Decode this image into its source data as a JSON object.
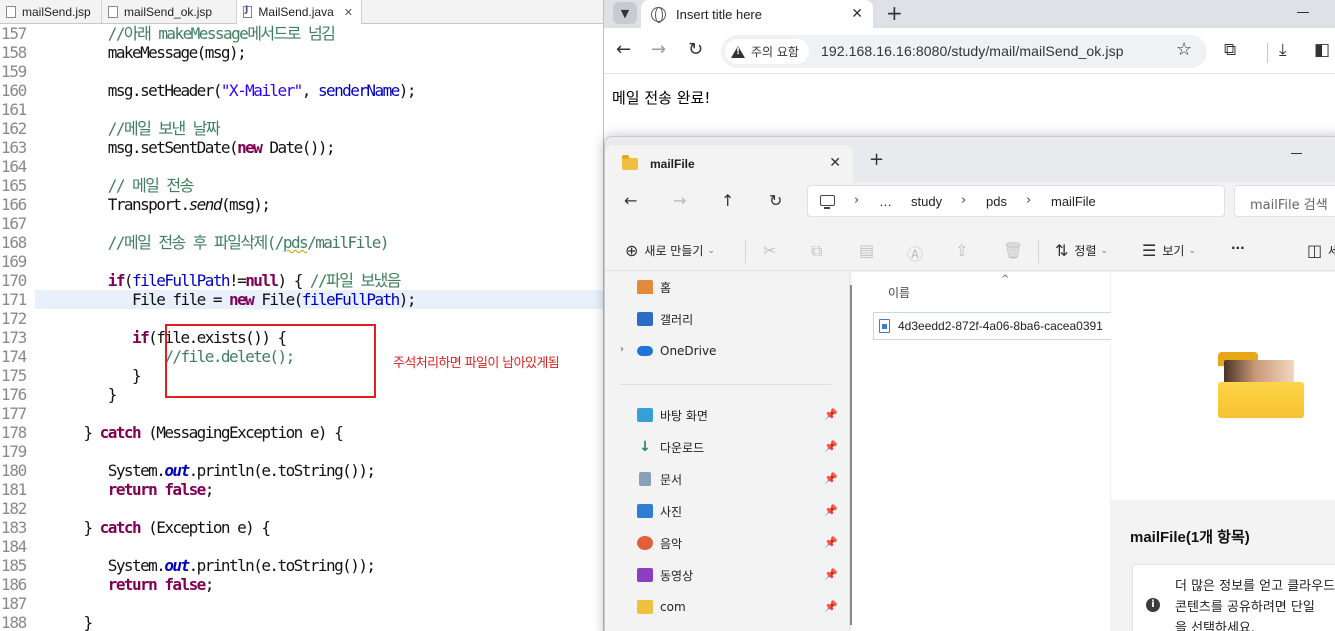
{
  "editor": {
    "tabs": [
      {
        "label": "mailSend.jsp"
      },
      {
        "label": "mailSend_ok.jsp"
      },
      {
        "label": "MailSend.java",
        "close": "✕"
      }
    ],
    "line_numbers": [
      "157",
      "158",
      "159",
      "160",
      "161",
      "162",
      "163",
      "164",
      "165",
      "166",
      "167",
      "168",
      "169",
      "170",
      "171",
      "172",
      "173",
      "174",
      "175",
      "176",
      "177",
      "178",
      "179",
      "180",
      "181",
      "182",
      "183",
      "184",
      "185",
      "186",
      "187",
      "188"
    ],
    "code": {
      "l157": "//아래 makeMessage메서드로 넘김",
      "l158": "makeMessage(msg);",
      "l160a": "msg.setHeader(",
      "l160s": "\"X-Mailer\"",
      "l160b": ", ",
      "l160f": "senderName",
      "l160c": ");",
      "l162": "//메일 보낸 날짜",
      "l163a": "msg.setSentDate(",
      "l163k": "new",
      "l163b": " Date());",
      "l165": "// 메일 전송",
      "l166a": "Transport.",
      "l166i": "send",
      "l166b": "(msg);",
      "l168a": "//메일 전송 후 파일삭제(/",
      "l168u": "pds",
      "l168b": "/mailFile)",
      "l170k": "if",
      "l170a": "(",
      "l170f": "fileFullPath",
      "l170b": "!=",
      "l170n": "null",
      "l170c": ") { ",
      "l170cm": "//파일 보냈음",
      "l171a": "File file = ",
      "l171k": "new",
      "l171b": " File(",
      "l171f": "fileFullPath",
      "l171c": ");",
      "l173k": "if",
      "l173a": "(file.exists()) {",
      "l174": "//file.delete();",
      "l175": "}",
      "l176": "}",
      "l178a": "} ",
      "l178k": "catch",
      "l178b": " (MessagingException e) {",
      "l180a": "System.",
      "l180o": "out",
      "l180b": ".println(e.toString());",
      "l181k": "return",
      "l181b": " ",
      "l181f": "false",
      "l181c": ";",
      "l183a": "} ",
      "l183k": "catch",
      "l183b": " (Exception e) {",
      "l185a": "System.",
      "l185o": "out",
      "l185b": ".println(e.toString());",
      "l186k": "return",
      "l186b": " ",
      "l186f": "false",
      "l186c": ";",
      "l188": "}"
    },
    "annotation": "주석처리하면 파일이 남아있게됨",
    "annotation_color": "#e02020"
  },
  "browser": {
    "tab_title": "Insert title here",
    "tab_close": "✕",
    "new_tab": "+",
    "security_chip": "주의 요함",
    "url": "192.168.16.16:8080/study/mail/mailSend_ok.jsp",
    "page_text": "메일 전송 완료!",
    "icons": [
      "back-arrow-icon",
      "forward-arrow-icon",
      "reload-icon",
      "warning-icon",
      "star-icon",
      "extensions-icon",
      "download-icon",
      "sidepanel-icon"
    ]
  },
  "explorer": {
    "tab_title": "mailFile",
    "tab_close": "✕",
    "new_tab": "+",
    "breadcrumb": [
      "…",
      "study",
      "pds",
      "mailFile"
    ],
    "search_placeholder": "mailFile 검색",
    "commands": {
      "new": "새로 만들기",
      "sort": "정렬",
      "view": "보기",
      "more": "···",
      "details": "세"
    },
    "nav_items": [
      {
        "label": "홈",
        "icon": "home-icon"
      },
      {
        "label": "갤러리",
        "icon": "gallery-icon"
      },
      {
        "label": "OneDrive",
        "icon": "onedrive-icon"
      },
      {
        "label": "바탕 화면",
        "icon": "desktop-icon"
      },
      {
        "label": "다운로드",
        "icon": "download-icon"
      },
      {
        "label": "문서",
        "icon": "documents-icon"
      },
      {
        "label": "사진",
        "icon": "pictures-icon"
      },
      {
        "label": "음악",
        "icon": "music-icon"
      },
      {
        "label": "동영상",
        "icon": "videos-icon"
      },
      {
        "label": "com",
        "icon": "folder-icon"
      }
    ],
    "column_header": "이름",
    "file_name": "4d3eedd2-872f-4a06-8ba6-cacea0391",
    "detail_title": "mailFile(1개 항목)",
    "info_lines": [
      "더 많은 정보를 얻고 클라우드",
      "콘텐츠를 공유하려면 단일",
      "을 선택하세요."
    ],
    "accent": "#f6c22f"
  }
}
